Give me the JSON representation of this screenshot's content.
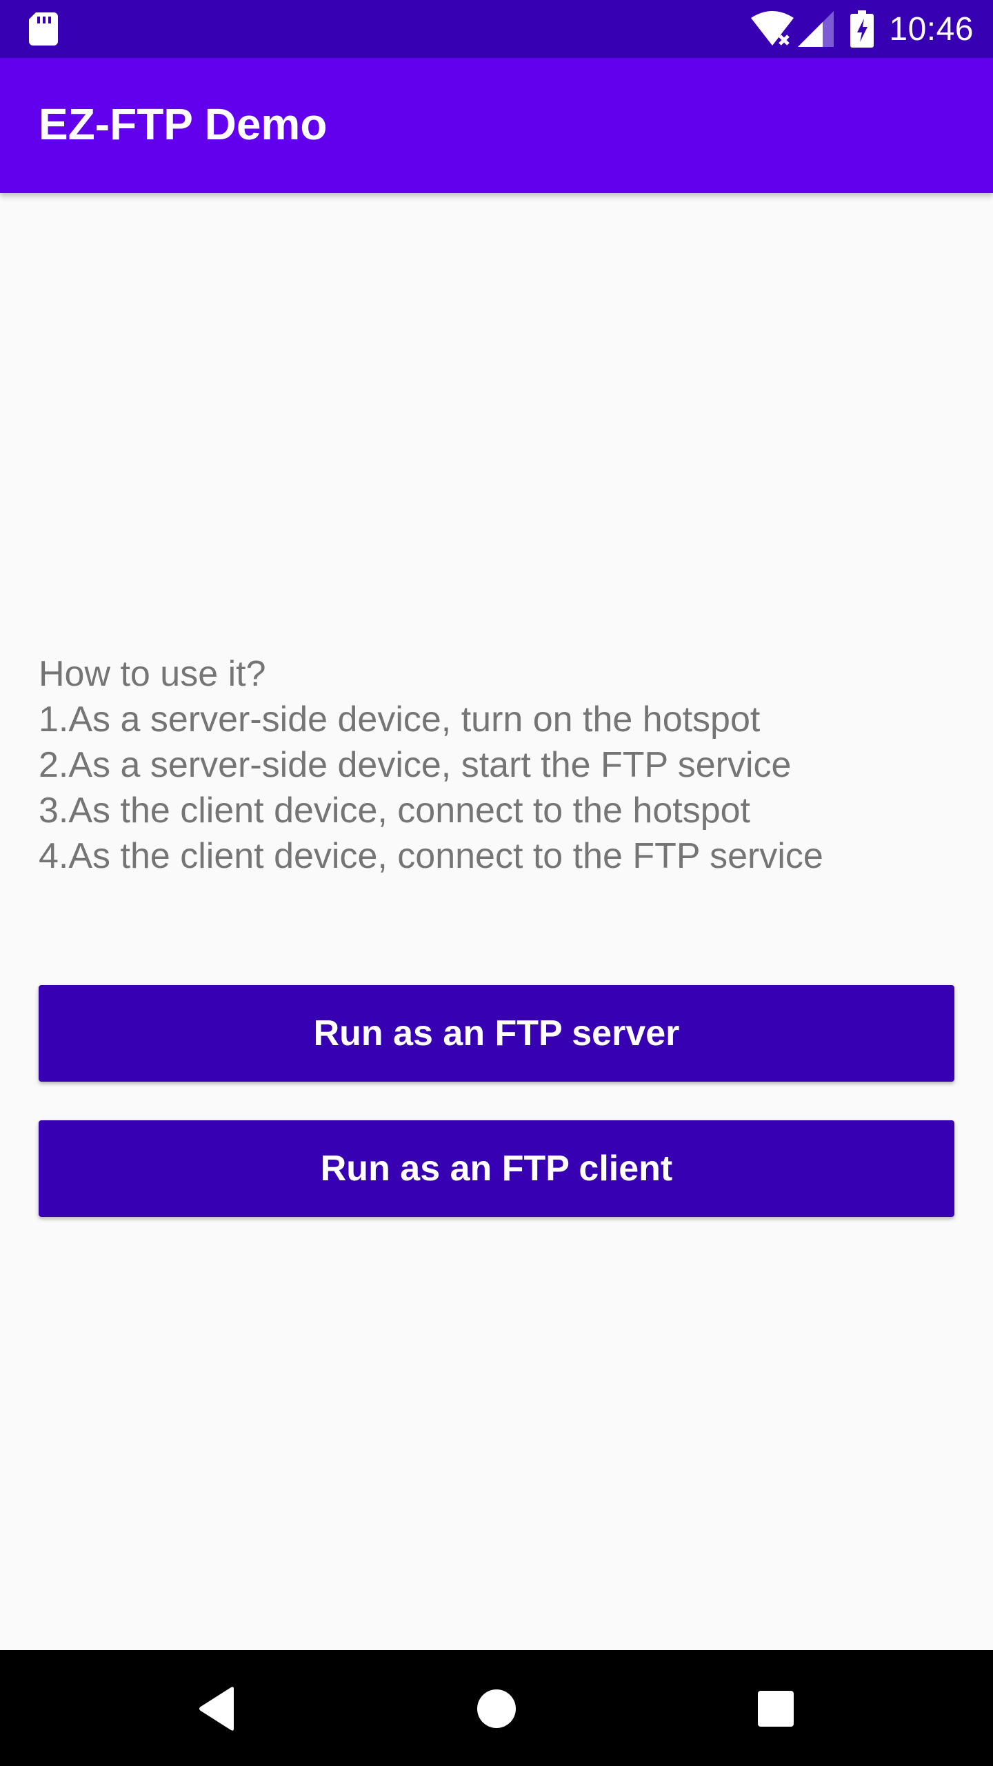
{
  "status_bar": {
    "time": "10:46",
    "icons": [
      "sd-card-icon",
      "wifi-no-internet-icon",
      "cell-signal-icon",
      "battery-charging-icon"
    ],
    "background_color": "#3700b3"
  },
  "app_bar": {
    "title": "EZ-FTP Demo",
    "background_color": "#6200ee"
  },
  "instructions": {
    "heading": "How to use it?",
    "steps": [
      "1.As a server-side device, turn on the hotspot",
      "2.As a server-side device, start the FTP service",
      "3.As the client device, connect to the hotspot",
      "4.As the client device, connect to the FTP service"
    ]
  },
  "buttons": {
    "server_label": "Run as an FTP server",
    "client_label": "Run as an FTP client",
    "color": "#3700b3"
  },
  "nav_bar": {
    "icons": [
      "back-icon",
      "home-icon",
      "recents-icon"
    ]
  }
}
